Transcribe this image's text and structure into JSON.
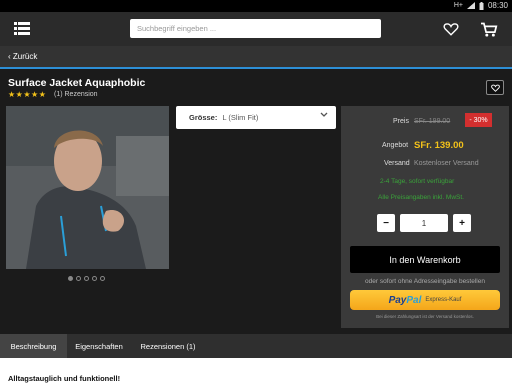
{
  "status_bar": {
    "network": "H+",
    "time": "08:30"
  },
  "header": {
    "search_placeholder": "Suchbegriff eingeben ..."
  },
  "nav": {
    "back_label": "Zurück"
  },
  "product": {
    "title": "Surface Jacket Aquaphobic",
    "stars": "★★★★★",
    "reviews": "(1) Rezension",
    "size_label": "Grösse:",
    "size_value": "L (Slim Fit)"
  },
  "pricing": {
    "price_label": "Preis",
    "old_price": "SFr. 199.00",
    "discount_badge": "- 30%",
    "offer_label": "Angebot",
    "offer_price": "SFr. 139.00",
    "shipping_label": "Versand",
    "shipping_value": "Kostenloser Versand",
    "availability": "2-4 Tage, sofort verfügbar",
    "tax_note": "Alle Preisangaben inkl. MwSt.",
    "quantity": "1",
    "minus": "−",
    "plus": "+",
    "cart_button": "In den Warenkorb",
    "or_text": "oder sofort ohne Adresseingabe bestellen",
    "paypal_pay": "Pay",
    "paypal_pal": "Pal",
    "paypal_express": "Express-Kauf",
    "paypal_note": "Bei dieser Zahlungsart ist der Versand kostenlos."
  },
  "tabs": [
    {
      "label": "Beschreibung"
    },
    {
      "label": "Eigenschaften"
    },
    {
      "label": "Rezensionen (1)"
    }
  ],
  "description": {
    "heading": "Alltagstauglich und funktionell!"
  },
  "colors": {
    "accent_blue": "#2d8fd6",
    "price_yellow": "#f3c21a",
    "badge_red": "#d32f2f",
    "green": "#3aa33a"
  }
}
